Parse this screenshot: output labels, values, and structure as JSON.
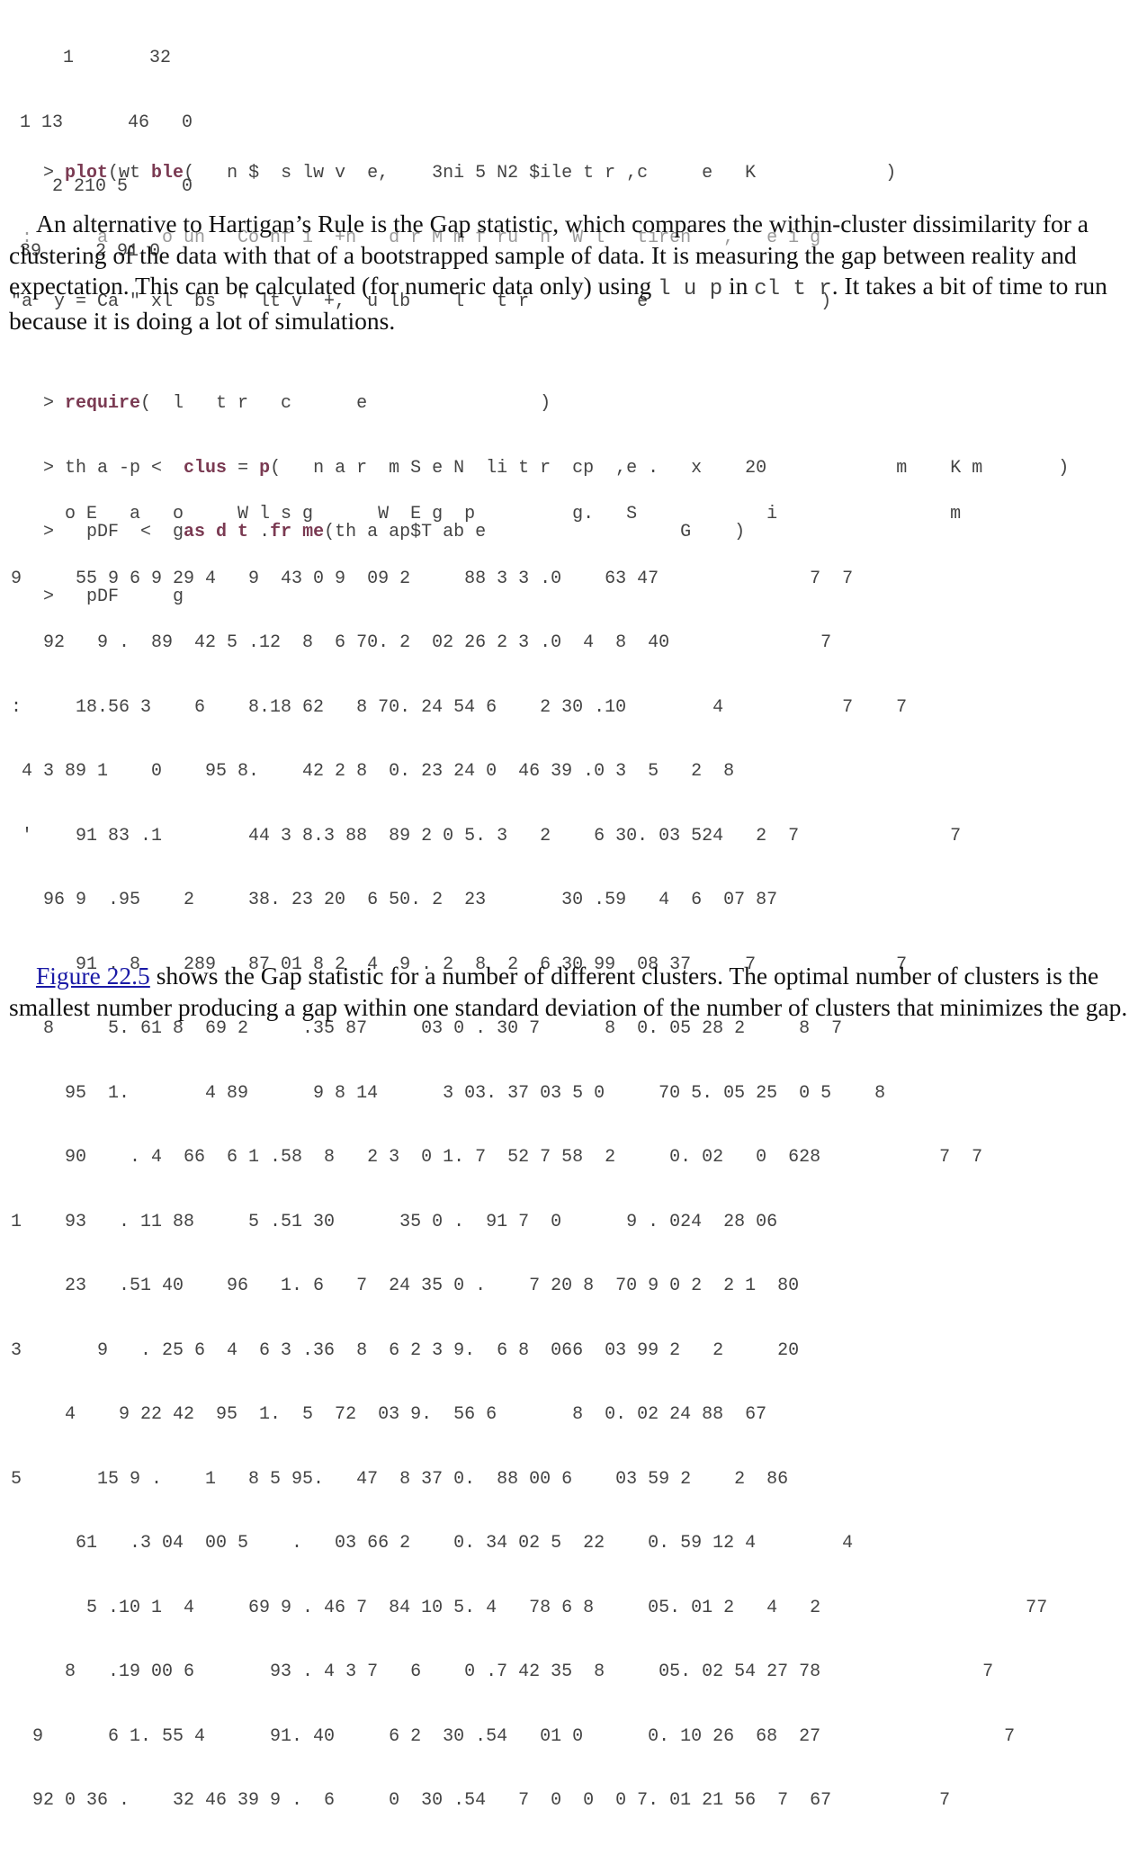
{
  "top_output": [
    "    1       32",
    "1 13      46   0",
    "   2 210 5     0",
    "39     2 91 0"
  ],
  "plot_code": {
    "line1": {
      "prompt": "    > ",
      "kw1": "plot",
      "rest1": "(wt ",
      "kw2": "ble",
      "rest2": "(   n $  s lw v  e,    3ni 5 N2 $ile t r ,c     e   K            )"
    },
    "line2": "  :      a     o un   Co nf i  +n   d r M m f ru  n  W l   tiren   ,   e i g",
    "line3": " \"a  y = Ca \" xl  bs  \" lt v  +,  u lb    l   t r          e                )"
  },
  "paragraph1": {
    "text_a": "An alternative to Hartigan’s Rule is the Gap statistic, which compares the within-cluster dissimilarity for a clustering of the data with that of a bootstrapped sample of data. It is measuring the gap between reality and expectation. This can be calculated (for numeric data only) using ",
    "code_a": "l u  p",
    "text_b": " in ",
    "code_b": "cl   t r",
    "text_c": ". It takes a bit of time to run because it is doing a lot of simulations."
  },
  "code2": [
    {
      "prompt": "    > ",
      "kw": "require",
      "rest": "(  l   t r   c      e                )"
    },
    {
      "prompt": "    > ",
      "pre": "th a -p <  ",
      "kw": "clus",
      "mid": " = ",
      "kw2": "p",
      "rest": "(   n a r  m S e N  li t r  cp  ,e .   x    20            m    K m       )"
    },
    {
      "prompt": "    >   ",
      "pre": "pDF  <  g",
      "kw": "as d t",
      "mid": " .",
      "kw2": "fr me",
      "rest": "(th a ap$T ab e                  G    )"
    },
    {
      "prompt": "    >   ",
      "pre": "pDF     g",
      "kw": "",
      "mid": "",
      "kw2": "",
      "rest": ""
    }
  ],
  "table_output": {
    "header": "      o E   a   o     W l s g      W  E g  p         g.   S            i                m",
    "rows": [
      " 9     55 9 6 9 29 4   9  43 0 9  09 2     88 3 3 .0    63 47              7  7",
      "    92   9 .  89  42 5 .12  8  6 70. 2  02 26 2 3 .0  4  8  40              7",
      " :     18.56 3    6    8.18 62   8 70. 24 54 6    2 30 .10        4           7    7",
      "  4 3 89 1    0    95 8.    42 2 8  0. 23 24 0  46 39 .0 3  5   2  8",
      "  '    91 83 .1        44 3 8.3 88  89 2 0 5. 3   2    6 30. 03 524   2  7              7",
      "    96 9  .95    2     38. 23 20  6 50. 2  23       30 .59   4  6  07 87",
      "       91 . 8    289   87 01 8 2  4  9 . 2  8  2  6 30 99  08 37     7             7",
      "    8     5. 61 8  69 2     .35 87     03 0 . 30 7      8  0. 05 28 2     8  7",
      "      95  1.       4 89      9 8 14      3 03. 37 03 5 0     70 5. 05 25  0 5    8",
      "      90    . 4  66  6 1 .58  8   2 3  0 1. 7  52 7 58  2     0. 02   0  628           7  7",
      " 1    93   . 11 88     5 .51 30      35 0 .  91 7  0      9 . 024  28 06",
      "      23   .51 40    96   1. 6   7  24 35 0 .    7 20 8  70 9 0 2  2 1  80",
      " 3       9   . 25 6  4  6 3 .36  8  6 2 3 9.  6 8  066  03 99 2   2     20",
      "      4    9 22 42  95  1.  5  72  03 9.  56 6       8  0. 02 24 88  67",
      " 5       15 9 .    1   8 5 95.   47  8 37 0.  88 00 6    03 59 2    2  86",
      "       61   .3 04  00 5    .   03 66 2    0. 34 02 5  22    0. 59 12 4        4",
      "        5 .10 1  4     69 9 . 46 7  84 10 5. 4   78 6 8     05. 01 2   4   2                   77",
      "      8   .19 00 6       93 . 4 3 7   6    0 .7 42 35  8     05. 02 54 27 78               7",
      "   9      6 1. 55 4      91. 40     6 2  30 .54   01 0      0. 10 26  68  27                 7",
      "   92 0 36 .    32 46 39 9 .  6     0  30 .54   7  0  0  0 7. 01 21 56  7  67          7"
    ]
  },
  "paragraph2": {
    "link": "Figure 22.5",
    "text": " shows the Gap statistic for a number of different clusters. The optimal number of clusters is the smallest number producing a gap within one standard deviation of the number of clusters that minimizes the gap."
  }
}
